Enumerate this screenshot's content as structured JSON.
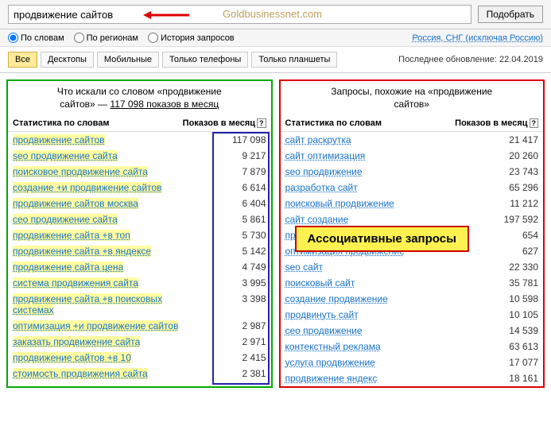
{
  "search": {
    "value": "продвижение сайтов",
    "watermark": "Goldbusinessnet.com",
    "button": "Подобрать"
  },
  "filters": {
    "by_words": "По словам",
    "by_regions": "По регионам",
    "history": "История запросов",
    "region": "Россия, СНГ (исключая Россию)"
  },
  "tabs": {
    "all": "Все",
    "desktops": "Десктопы",
    "mobiles": "Мобильные",
    "phones": "Только телефоны",
    "tablets": "Только планшеты"
  },
  "last_update": "Последнее обновление: 22.04.2019",
  "left": {
    "title_1": "Что искали со словом «продвижение",
    "title_2": "сайтов» — ",
    "count": "117 098 показов в месяц",
    "th_words": "Статистика по словам",
    "th_count": "Показов в месяц",
    "rows": [
      {
        "kw": "продвижение сайтов",
        "cnt": "117 098"
      },
      {
        "kw": "seo продвижение сайта",
        "cnt": "9 217"
      },
      {
        "kw": "поисковое продвижение сайта",
        "cnt": "7 879"
      },
      {
        "kw": "создание +и продвижение сайтов",
        "cnt": "6 614"
      },
      {
        "kw": "продвижение сайтов москва",
        "cnt": "6 404"
      },
      {
        "kw": "сео продвижение сайта",
        "cnt": "5 861"
      },
      {
        "kw": "продвижение сайта +в топ",
        "cnt": "5 730"
      },
      {
        "kw": "продвижение сайта +в яндексе",
        "cnt": "5 142"
      },
      {
        "kw": "продвижение сайта цена",
        "cnt": "4 749"
      },
      {
        "kw": "система продвижения сайта",
        "cnt": "3 995"
      },
      {
        "kw": "продвижение сайта +в поисковых системах",
        "cnt": "3 398"
      },
      {
        "kw": "оптимизация +и продвижение сайтов",
        "cnt": "2 987"
      },
      {
        "kw": "заказать продвижение сайта",
        "cnt": "2 971"
      },
      {
        "kw": "продвижение сайтов +в 10",
        "cnt": "2 415"
      },
      {
        "kw": "стоимость продвижения сайта",
        "cnt": "2 381"
      }
    ]
  },
  "right": {
    "title_1": "Запросы, похожие на «продвижение",
    "title_2": "сайтов»",
    "th_words": "Статистика по словам",
    "th_count": "Показов в месяц",
    "badge": "Ассоциативные запросы",
    "rows": [
      {
        "kw": "сайт раскрутка",
        "cnt": "21 417"
      },
      {
        "kw": "сайт оптимизация",
        "cnt": "20 260"
      },
      {
        "kw": "seo продвижение",
        "cnt": "23 743"
      },
      {
        "kw": "разработка сайт",
        "cnt": "65 296"
      },
      {
        "kw": "поисковый продвижение",
        "cnt": "11 212"
      },
      {
        "kw": "сайт создание",
        "cnt": "197 592"
      },
      {
        "kw": "продвижение интернет",
        "cnt": "654"
      },
      {
        "kw": "оптимизация продвижение",
        "cnt": "627"
      },
      {
        "kw": "seo сайт",
        "cnt": "22 330"
      },
      {
        "kw": "поисковый сайт",
        "cnt": "35 781"
      },
      {
        "kw": "создание продвижение",
        "cnt": "10 598"
      },
      {
        "kw": "продвинуть сайт",
        "cnt": "10 105"
      },
      {
        "kw": "сео продвижение",
        "cnt": "14 539"
      },
      {
        "kw": "контекстный реклама",
        "cnt": "63 613"
      },
      {
        "kw": "услуга продвижение",
        "cnt": "17 077"
      },
      {
        "kw": "продвижение яндекс",
        "cnt": "18 161"
      }
    ]
  }
}
